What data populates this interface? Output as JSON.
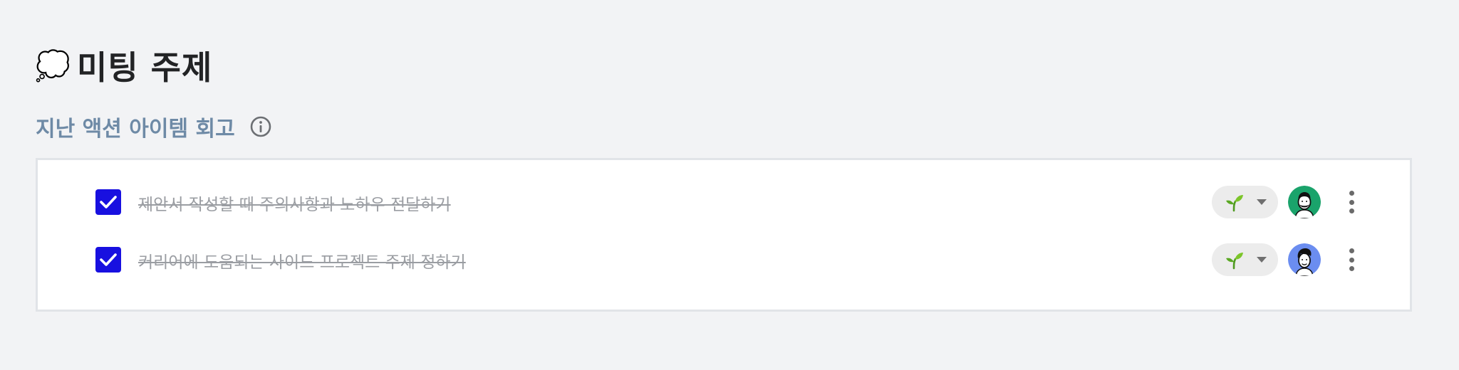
{
  "header": {
    "emoji": "💭",
    "title": "미팅 주제"
  },
  "section": {
    "title": "지난 액션 아이템 회고",
    "info_icon": "info-circle-icon"
  },
  "action_items": [
    {
      "text": "제안서 작성할 때 주의사항과 노하우 전달하기",
      "checked": true,
      "stage_icon": "sprout-icon",
      "avatar_color": "#1aa36b"
    },
    {
      "text": "커리어에 도움되는 사이드 프로젝트 주제 정하기",
      "checked": true,
      "stage_icon": "sprout-icon",
      "avatar_color": "#6b8df0"
    }
  ],
  "colors": {
    "checkbox": "#1810e0",
    "section_title": "#6e8aa6",
    "card_border": "#e1e4e8",
    "background": "#f2f3f5"
  }
}
